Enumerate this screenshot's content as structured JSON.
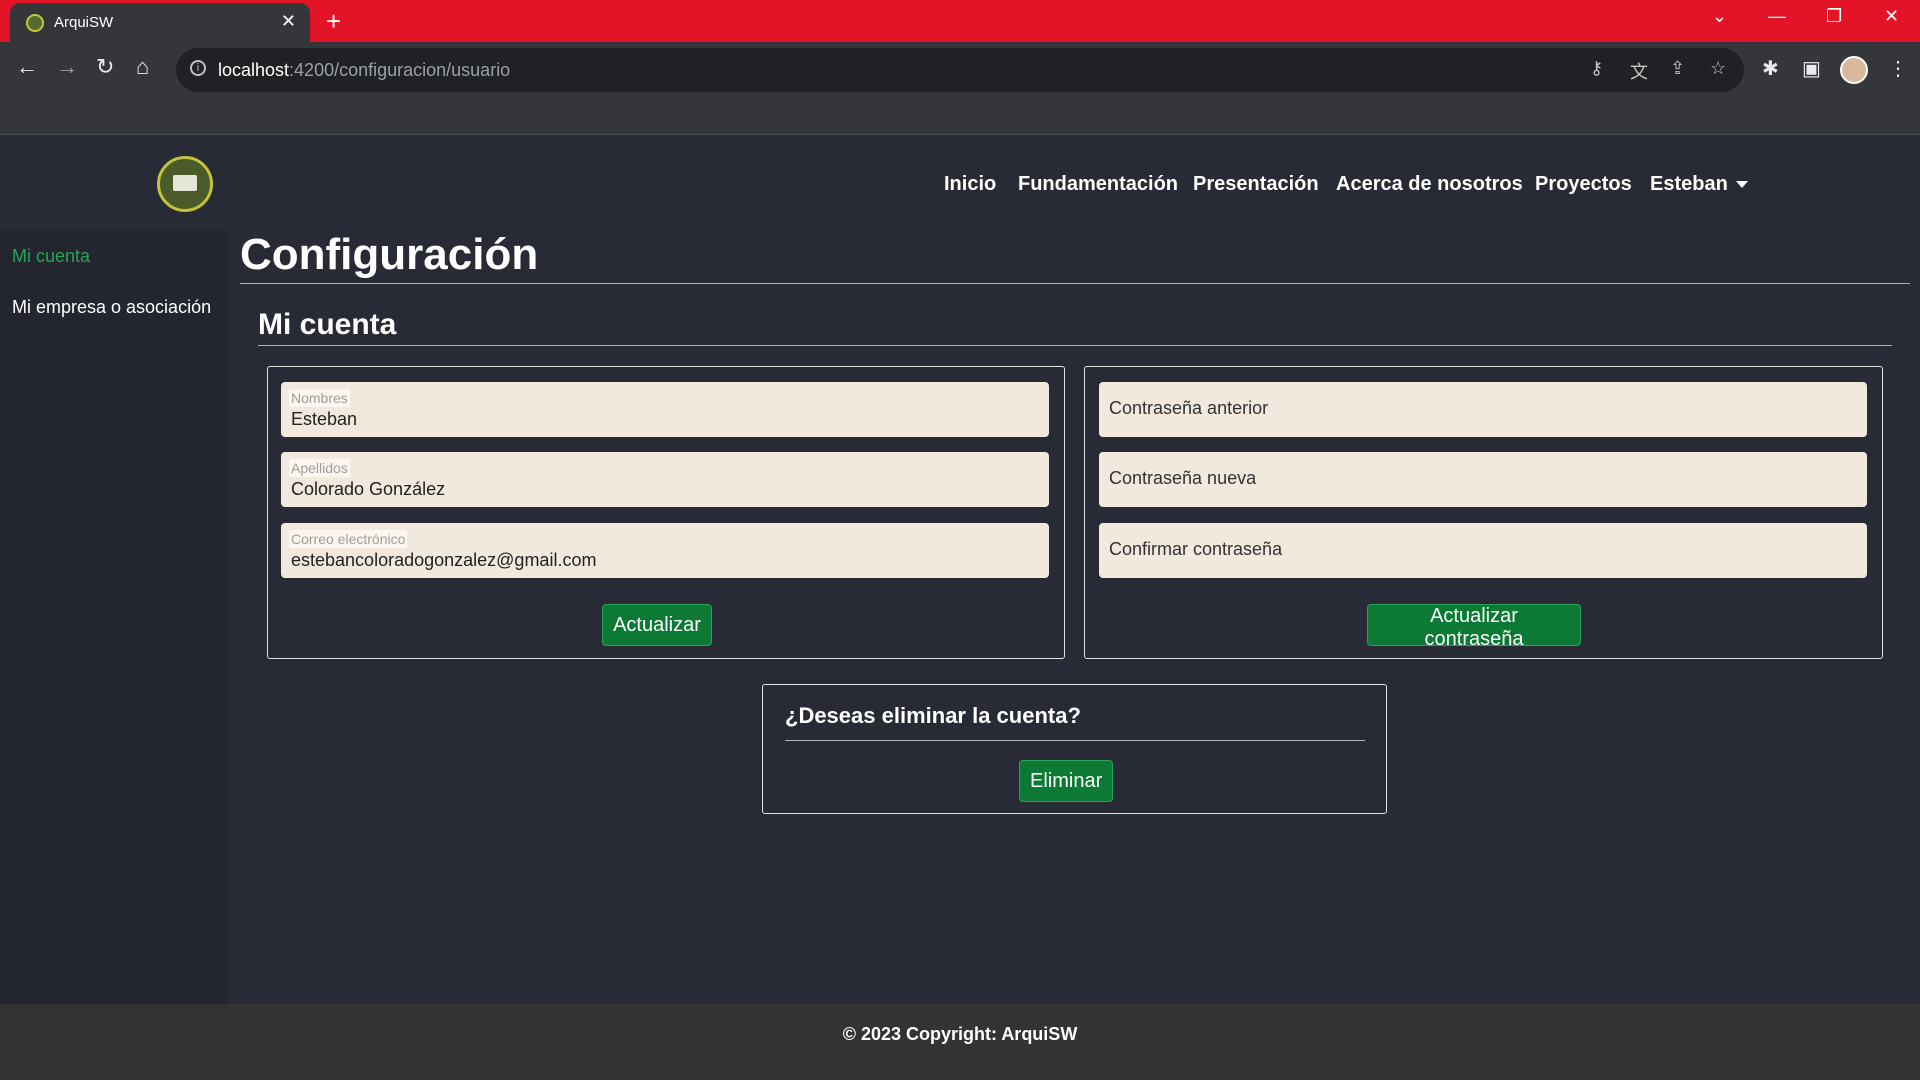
{
  "browser": {
    "tab_title": "ArquiSW",
    "url_host": "localhost",
    "url_rest": ":4200/configuracion/usuario"
  },
  "site": {
    "nav": [
      "Inicio",
      "Fundamentación",
      "Presentación",
      "Acerca de nosotros",
      "Proyectos"
    ],
    "user_menu": "Esteban"
  },
  "sidebar": {
    "items": [
      {
        "label": "Mi cuenta",
        "active": true
      },
      {
        "label": "Mi empresa o asociación",
        "active": false
      }
    ]
  },
  "page": {
    "title": "Configuración",
    "section_title": "Mi cuenta"
  },
  "profile_form": {
    "nombres_label": "Nombres",
    "nombres_value": "Esteban",
    "apellidos_label": "Apellidos",
    "apellidos_value": "Colorado González",
    "correo_label": "Correo electrónico",
    "correo_value": "estebancoloradogonzalez@gmail.com",
    "submit_label": "Actualizar"
  },
  "password_form": {
    "old_placeholder": "Contraseña anterior",
    "new_placeholder": "Contraseña nueva",
    "confirm_placeholder": "Confirmar contraseña",
    "submit_label": "Actualizar contraseña"
  },
  "delete_account": {
    "question": "¿Deseas eliminar la cuenta?",
    "button_label": "Eliminar"
  },
  "footer": {
    "text": "© 2023 Copyright: ArquiSW"
  },
  "colors": {
    "tabbar": "#e31428",
    "background": "#282b36",
    "sidebar_active": "#27a35a",
    "button": "#0c7a34",
    "field_bg": "#f1e9dd"
  }
}
